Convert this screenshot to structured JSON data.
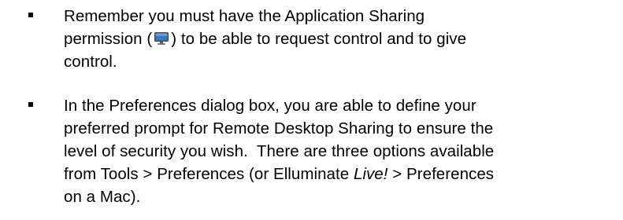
{
  "bullets": [
    {
      "line1": "Remember you must have the Application Sharing",
      "line2_before": "permission (",
      "icon": "application-sharing-monitor-icon",
      "line2_after": ") to be able to request control and to give",
      "line3": "control."
    },
    {
      "line1": "In the Preferences dialog box, you are able to define your",
      "line2": "preferred prompt for Remote Desktop Sharing to ensure the",
      "line3": "level of security you wish.  There are three options available",
      "line4_before": "from Tools > Preferences (or Elluminate ",
      "line4_italic": "Live!",
      "line4_after": " > Preferences",
      "line5": "on a Mac)."
    }
  ],
  "colors": {
    "text": "#000000",
    "icon_screen": "#3a78c4",
    "icon_frame": "#4a4a4a"
  }
}
